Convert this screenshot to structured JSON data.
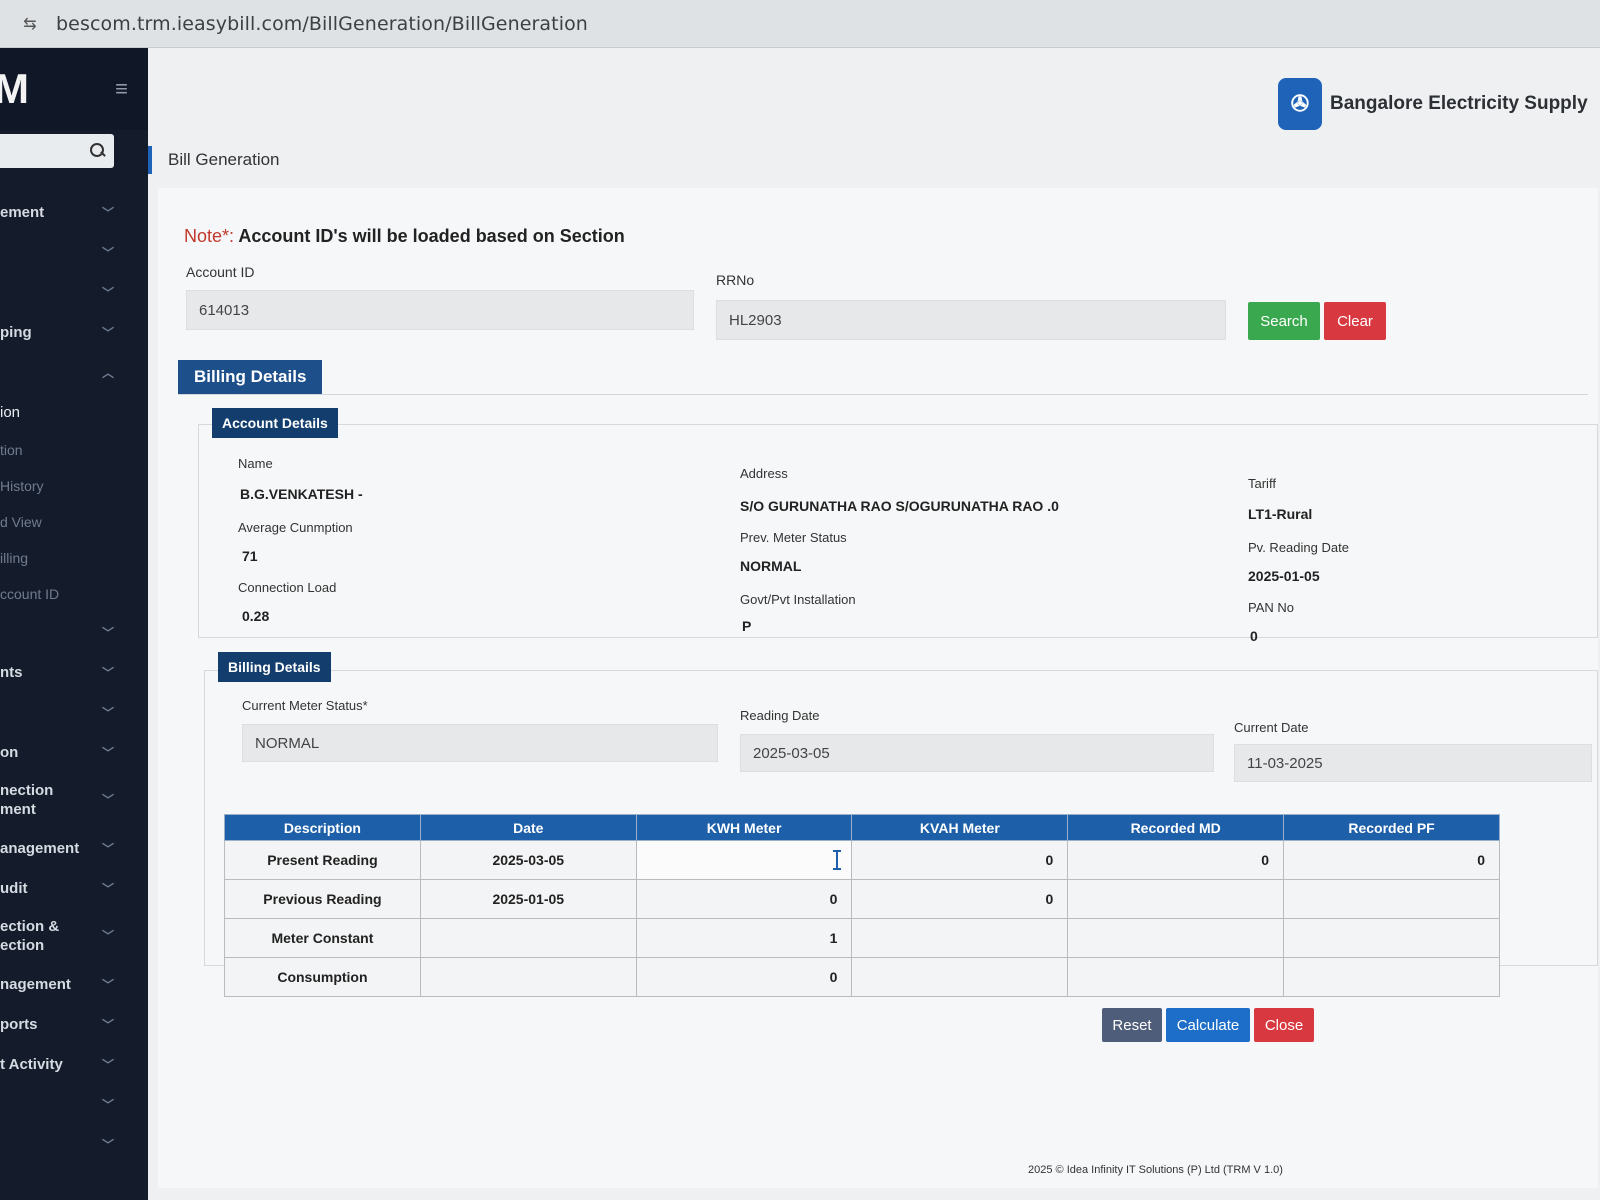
{
  "browser": {
    "url": "bescom.trm.ieasybill.com/BillGeneration/BillGeneration"
  },
  "sidebar": {
    "logo": "M",
    "items": [
      {
        "label": "ement",
        "kind": "group"
      },
      {
        "label": "",
        "kind": "group"
      },
      {
        "label": "",
        "kind": "group"
      },
      {
        "label": "ping",
        "kind": "group"
      },
      {
        "label": "",
        "kind": "group-open"
      },
      {
        "label": "ion",
        "kind": "active"
      },
      {
        "label": "tion",
        "kind": "sub"
      },
      {
        "label": "History",
        "kind": "sub"
      },
      {
        "label": "d View",
        "kind": "sub"
      },
      {
        "label": "illing",
        "kind": "sub"
      },
      {
        "label": "ccount ID",
        "kind": "sub"
      },
      {
        "label": "",
        "kind": "group"
      },
      {
        "label": "nts",
        "kind": "group"
      },
      {
        "label": "",
        "kind": "group"
      },
      {
        "label": "on",
        "kind": "group"
      },
      {
        "label": "nection\nment",
        "kind": "group-tall"
      },
      {
        "label": "anagement",
        "kind": "group"
      },
      {
        "label": "udit",
        "kind": "group"
      },
      {
        "label": "ection &\nection",
        "kind": "group-tall"
      },
      {
        "label": "nagement",
        "kind": "group"
      },
      {
        "label": "ports",
        "kind": "group"
      },
      {
        "label": "t Activity",
        "kind": "group"
      },
      {
        "label": "",
        "kind": "group"
      },
      {
        "label": "",
        "kind": "group"
      }
    ]
  },
  "header": {
    "brand_name": "Bangalore Electricity Supply",
    "page_title": "Bill Generation"
  },
  "form": {
    "note_prefix": "Note*:",
    "note_text": "Account ID's will be loaded based on Section",
    "account_id_label": "Account ID",
    "account_id_value": "614013",
    "rrno_label": "RRNo",
    "rrno_value": "HL2903",
    "search_label": "Search",
    "clear_label": "Clear"
  },
  "billing_details": {
    "section_title": "Billing Details",
    "account_tab": "Account Details",
    "fields": {
      "name_label": "Name",
      "name_value": "B.G.VENKATESH -",
      "address_label": "Address",
      "address_value": "S/O  GURUNATHA RAO  S/OGURUNATHA RAO  .0",
      "tariff_label": "Tariff",
      "tariff_value": "LT1-Rural",
      "avg_label": "Average Cunmption",
      "avg_value": "71",
      "prev_status_label": "Prev. Meter Status",
      "prev_status_value": "NORMAL",
      "pv_date_label": "Pv. Reading Date",
      "pv_date_value": "2025-01-05",
      "load_label": "Connection Load",
      "load_value": "0.28",
      "govt_label": "Govt/Pvt Installation",
      "govt_value": "P",
      "pan_label": "PAN No",
      "pan_value": "0"
    },
    "billing_tab": "Billing Details",
    "current_status_label": "Current Meter Status*",
    "current_status_value": "NORMAL",
    "reading_date_label": "Reading Date",
    "reading_date_value": "2025-03-05",
    "current_date_label": "Current Date",
    "current_date_value": "11-03-2025"
  },
  "table": {
    "headers": [
      "Description",
      "Date",
      "KWH Meter",
      "KVAH Meter",
      "Recorded MD",
      "Recorded PF"
    ],
    "rows": [
      {
        "desc": "Present Reading",
        "date": "2025-03-05",
        "kwh": "",
        "kvah": "0",
        "md": "0",
        "pf": "0"
      },
      {
        "desc": "Previous Reading",
        "date": "2025-01-05",
        "kwh": "0",
        "kvah": "0",
        "md": "",
        "pf": ""
      },
      {
        "desc": "Meter Constant",
        "date": "",
        "kwh": "1",
        "kvah": "",
        "md": "",
        "pf": ""
      },
      {
        "desc": "Consumption",
        "date": "",
        "kwh": "0",
        "kvah": "",
        "md": "",
        "pf": ""
      }
    ]
  },
  "actions": {
    "reset_label": "Reset",
    "calculate_label": "Calculate",
    "close_label": "Close"
  },
  "footer": {
    "text": "2025 © Idea Infinity IT Solutions (P) Ltd (TRM V 1.0)"
  },
  "colors": {
    "sidebar_bg": "#141c2b",
    "primary": "#1d5fa8",
    "search_green": "#3aa84e",
    "danger_red": "#d8383f"
  }
}
